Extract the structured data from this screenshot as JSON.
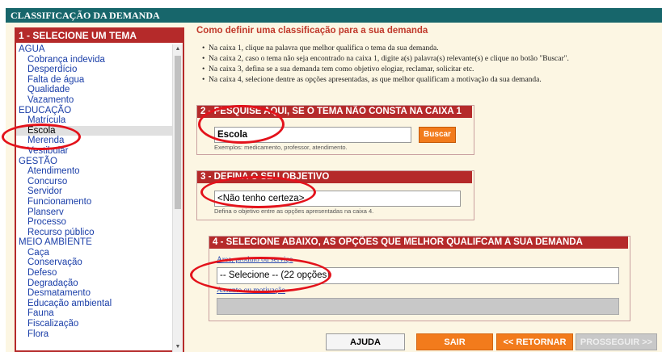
{
  "header": {
    "title": "CLASSIFICAÇÃO DA DEMANDA"
  },
  "box1": {
    "title": "1 - SELECIONE UM TEMA",
    "items": [
      {
        "label": "AGUA",
        "level": "cat"
      },
      {
        "label": "Cobrança indevida",
        "level": "sub"
      },
      {
        "label": "Desperdício",
        "level": "sub"
      },
      {
        "label": "Falta de água",
        "level": "sub"
      },
      {
        "label": "Qualidade",
        "level": "sub"
      },
      {
        "label": "Vazamento",
        "level": "sub"
      },
      {
        "label": "EDUCAÇÃO",
        "level": "cat"
      },
      {
        "label": "Matrícula",
        "level": "sub"
      },
      {
        "label": "Escola",
        "level": "sub",
        "selected": true
      },
      {
        "label": "Merenda",
        "level": "sub"
      },
      {
        "label": "Vestibular",
        "level": "sub"
      },
      {
        "label": "GESTÃO",
        "level": "cat"
      },
      {
        "label": "Atendimento",
        "level": "sub"
      },
      {
        "label": "Concurso",
        "level": "sub"
      },
      {
        "label": "Servidor",
        "level": "sub"
      },
      {
        "label": "Funcionamento",
        "level": "sub"
      },
      {
        "label": "Planserv",
        "level": "sub"
      },
      {
        "label": "Processo",
        "level": "sub"
      },
      {
        "label": "Recurso público",
        "level": "sub"
      },
      {
        "label": "MEIO AMBIENTE",
        "level": "cat"
      },
      {
        "label": "Caça",
        "level": "sub"
      },
      {
        "label": "Conservação",
        "level": "sub"
      },
      {
        "label": "Defeso",
        "level": "sub"
      },
      {
        "label": "Degradação",
        "level": "sub"
      },
      {
        "label": "Desmatamento",
        "level": "sub"
      },
      {
        "label": "Educação ambiental",
        "level": "sub"
      },
      {
        "label": "Fauna",
        "level": "sub"
      },
      {
        "label": "Fiscalização",
        "level": "sub"
      },
      {
        "label": "Flora",
        "level": "sub"
      }
    ]
  },
  "instructions": {
    "title": "Como definir uma classificação para a sua demanda",
    "items": [
      "Na caixa 1, clique na palavra que melhor qualifica o tema da sua demanda.",
      "Na caixa 2, caso o tema não seja encontrado na caixa 1, digite a(s) palavra(s) relevante(s) e clique no botão \"Buscar\".",
      "Na caixa 3, defina se a sua demanda tem como objetivo elogiar, reclamar, solicitar etc.",
      "Na caixa 4, selecione dentre as opções apresentadas, as que melhor qualificam a motivação da sua demanda."
    ]
  },
  "box2": {
    "title": "2 - PESQUISE AQUI, SE O TEMA NÃO CONSTA NA CAIXA 1",
    "value": "Escola",
    "button": "Buscar",
    "hint": "Exemplos: medicamento, professor, atendimento."
  },
  "box3": {
    "title": "3 - DEFINA O SEU OBJETIVO",
    "value": "<Não tenho certeza>",
    "hint": "Defina o objetivo entre as opções apresentadas na caixa 4."
  },
  "box4": {
    "title": "4 - SELECIONE ABAIXO, AS OPÇÕES QUE MELHOR QUALIFCAM A SUA DEMANDA",
    "label1": "Area, produto ou serviço",
    "select1": "-- Selecione -- (22 opções)",
    "label2": "Assunto ou motivação",
    "select2": ""
  },
  "buttons": {
    "ajuda": "AJUDA",
    "sair": "SAIR",
    "retornar": "<< RETORNAR",
    "prosseguir": "PROSSEGUIR >>"
  },
  "colors": {
    "header_bg": "#17666b",
    "box_header_red": "#b52a2a",
    "accent_orange": "#f27b1c",
    "annotation_red": "#e3121b",
    "link_blue": "#1a3ea8"
  },
  "icons": [
    "scroll-up-arrow-icon",
    "scroll-down-arrow-icon"
  ]
}
